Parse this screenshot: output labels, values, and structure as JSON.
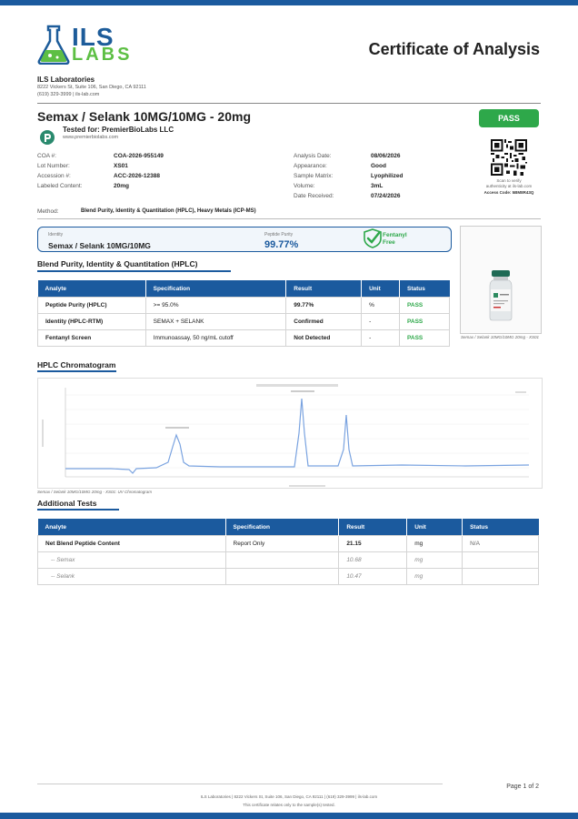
{
  "header": {
    "logo_ils": "ILS",
    "logo_labs": "LABS",
    "title": "Certificate of Analysis",
    "lab_name": "ILS Laboratories",
    "lab_address": "8222 Vickers St, Suite 106, San Diego, CA 92111",
    "lab_contact": "(619) 329-3999  |  ils-lab.com"
  },
  "product": {
    "title": "Semax / Selank 10MG/10MG - 20mg",
    "status": "PASS",
    "tested_for": "Tested for: PremierBioLabs LLC",
    "client_url": "www.premierbiolabs.com"
  },
  "info": {
    "left": [
      {
        "label": "COA #:",
        "value": "COA-2026-955149"
      },
      {
        "label": "Lot Number:",
        "value": "XS01"
      },
      {
        "label": "Accession #:",
        "value": "ACC-2026-12388"
      },
      {
        "label": "Labeled Content:",
        "value": "20mg"
      }
    ],
    "right": [
      {
        "label": "Analysis Date:",
        "value": "08/06/2026"
      },
      {
        "label": "Appearance:",
        "value": "Good"
      },
      {
        "label": "Sample Matrix:",
        "value": "Lyophilized"
      },
      {
        "label": "Volume:",
        "value": "3mL"
      },
      {
        "label": "Date Received:",
        "value": "07/24/2026"
      }
    ],
    "scan_text_1": "Scan to verify",
    "scan_text_2": "authenticity at ils-lab.com",
    "access_code": "Access Code: 5BM8R43Q"
  },
  "method": {
    "label": "Method:",
    "value": "Blend Purity, Identity & Quantitation (HPLC), Heavy Metals (ICP-MS)"
  },
  "summary": {
    "identity_label": "Identity",
    "identity_value": "Semax / Selank 10MG/10MG",
    "purity_label": "Peptide Purity",
    "purity_value": "99.77%",
    "fentanyl_line1": "Fentanyl",
    "fentanyl_line2": "Free"
  },
  "photo_caption": "Semax / Selank 10MG/10MG 20mg - XS01",
  "hplc_table": {
    "heading": "Blend Purity, Identity & Quantitation (HPLC)",
    "headers": [
      "Analyte",
      "Specification",
      "Result",
      "Unit",
      "Status"
    ],
    "rows": [
      [
        "Peptide Purity (HPLC)",
        ">= 95.0%",
        "99.77%",
        "%",
        "PASS"
      ],
      [
        "Identity (HPLC-RTM)",
        "SEMAX + SELANK",
        "Confirmed",
        "-",
        "PASS"
      ],
      [
        "Fentanyl Screen",
        "Immunoassay, 50 ng/mL cutoff",
        "Not Detected",
        "-",
        "PASS"
      ]
    ]
  },
  "chromatogram": {
    "heading": "HPLC Chromatogram",
    "caption": "Semax / Selank 10MG/10MG 20mg - XS01: UV Chromatogram"
  },
  "additional": {
    "heading": "Additional Tests",
    "headers": [
      "Analyte",
      "Specification",
      "Result",
      "Unit",
      "Status"
    ],
    "rows": [
      [
        "Net Blend Peptide Content",
        "Report Only",
        "21.15",
        "mg",
        "N/A"
      ],
      [
        "-- Semax",
        "",
        "10.68",
        "mg",
        ""
      ],
      [
        "-- Selank",
        "",
        "10.47",
        "mg",
        ""
      ]
    ]
  },
  "footer": {
    "line1": "ILS Laboratories  |  8222 Vickers St, Suite 106, San Diego, CA 92111  |  (619) 329-3999  |  ils-lab.com",
    "line2": "This certificate relates only to the sample(s) tested.",
    "page": "Page 1 of 2"
  },
  "colors": {
    "brand_blue": "#1b5a9e",
    "pass_green": "#2ea84a",
    "labs_green": "#5dbf44"
  }
}
